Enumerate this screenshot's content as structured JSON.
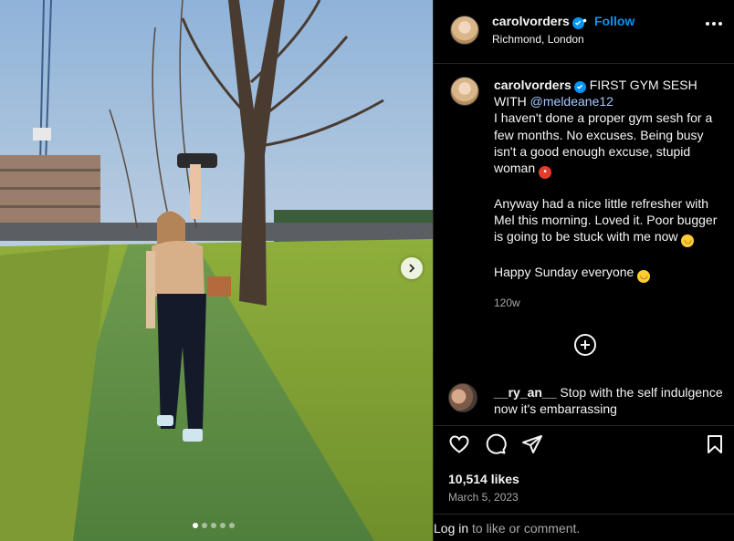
{
  "post": {
    "username": "carolvorders",
    "follow_label": "Follow",
    "separator": "•",
    "location": "Richmond, London",
    "caption": {
      "line1_rest": "FIRST GYM SESH",
      "line2_prefix": "WITH",
      "mention": "@meldeane12",
      "para1": "I haven't done a proper gym sesh for a few months. No excuses. Being busy isn't a good enough excuse, stupid woman",
      "para2": "Anyway had a nice little refresher with Mel this morning. Loved it. Poor bugger is going to be stuck with me now",
      "para3": "Happy Sunday everyone",
      "time": "120w"
    },
    "comment": {
      "username": "__ry_an__",
      "text": "Stop with the self indulgence now it's embarrassing"
    },
    "likes": "10,514 likes",
    "date": "March 5, 2023",
    "login_link": "Log in",
    "login_rest": " to like or comment."
  },
  "carousel": {
    "count": 5,
    "active_index": 0
  },
  "icons": {
    "verified": "verified-badge-icon",
    "more": "more-options-icon",
    "heart": "heart-icon",
    "comment": "comment-icon",
    "share": "share-icon",
    "save": "bookmark-icon",
    "load": "plus-circle-icon",
    "next": "chevron-right-icon"
  },
  "colors": {
    "accent": "#0095f6",
    "background": "#000000",
    "text": "#f5f5f5",
    "muted": "#a8a8a8"
  }
}
